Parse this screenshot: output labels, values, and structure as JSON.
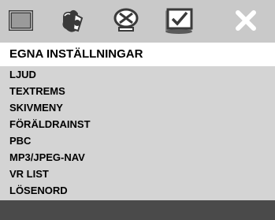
{
  "icons": [
    {
      "name": "display-icon"
    },
    {
      "name": "audio-icon"
    },
    {
      "name": "speaker-settings-icon"
    },
    {
      "name": "preferences-icon"
    },
    {
      "name": "close-icon"
    }
  ],
  "title": "EGNA INSTÄLLNINGAR",
  "menu": {
    "items": [
      {
        "label": "LJUD"
      },
      {
        "label": "TEXTREMS"
      },
      {
        "label": "SKIVMENY"
      },
      {
        "label": "FÖRÄLDRAINST"
      },
      {
        "label": "PBC"
      },
      {
        "label": "MP3/JPEG-NAV"
      },
      {
        "label": "VR LIST"
      },
      {
        "label": "LÖSENORD"
      }
    ]
  },
  "colors": {
    "background": "#c9c9c9",
    "title_bar": "#ffffff",
    "menu_panel": "#d4d4d4",
    "footer": "#4a4a4a",
    "icon_dark": "#3a3a3a"
  }
}
